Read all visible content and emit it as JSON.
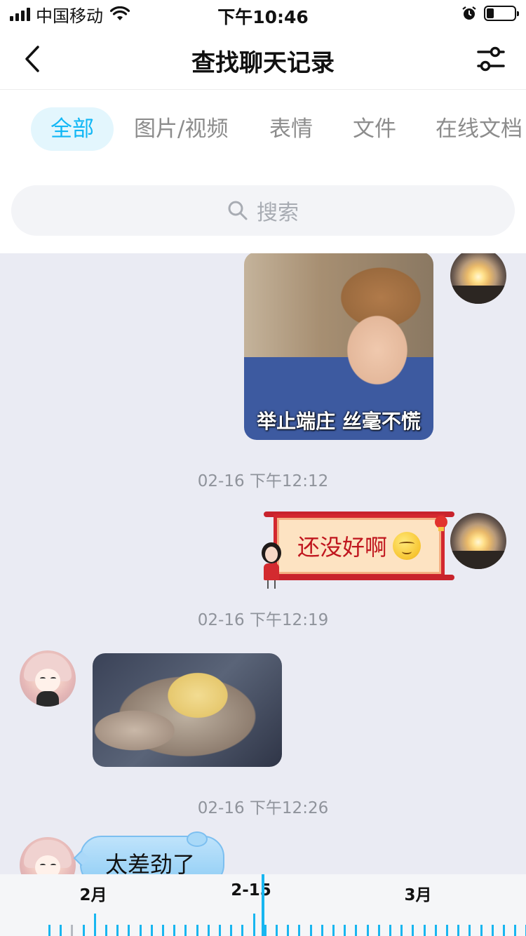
{
  "status_bar": {
    "carrier": "中国移动",
    "time": "下午10:46",
    "battery_level": 0.25
  },
  "nav": {
    "title": "查找聊天记录"
  },
  "tabs": [
    {
      "label": "全部",
      "active": true
    },
    {
      "label": "图片/视频",
      "active": false
    },
    {
      "label": "表情",
      "active": false
    },
    {
      "label": "文件",
      "active": false
    },
    {
      "label": "在线文档",
      "active": false
    }
  ],
  "search": {
    "placeholder": "搜索"
  },
  "messages": {
    "image_caption": "举止端庄 丝毫不慌",
    "timestamps": [
      "02-16 下午12:12",
      "02-16 下午12:19",
      "02-16 下午12:26"
    ],
    "text1": "还没好啊",
    "text2": "太差劲了"
  },
  "timeline": {
    "labels": [
      "2月",
      "2-15",
      "3月"
    ],
    "current": "2-15"
  },
  "colors": {
    "accent": "#12b7f5",
    "chat_bg": "#eaebf3",
    "tab_active_bg": "#e3f6fd"
  }
}
